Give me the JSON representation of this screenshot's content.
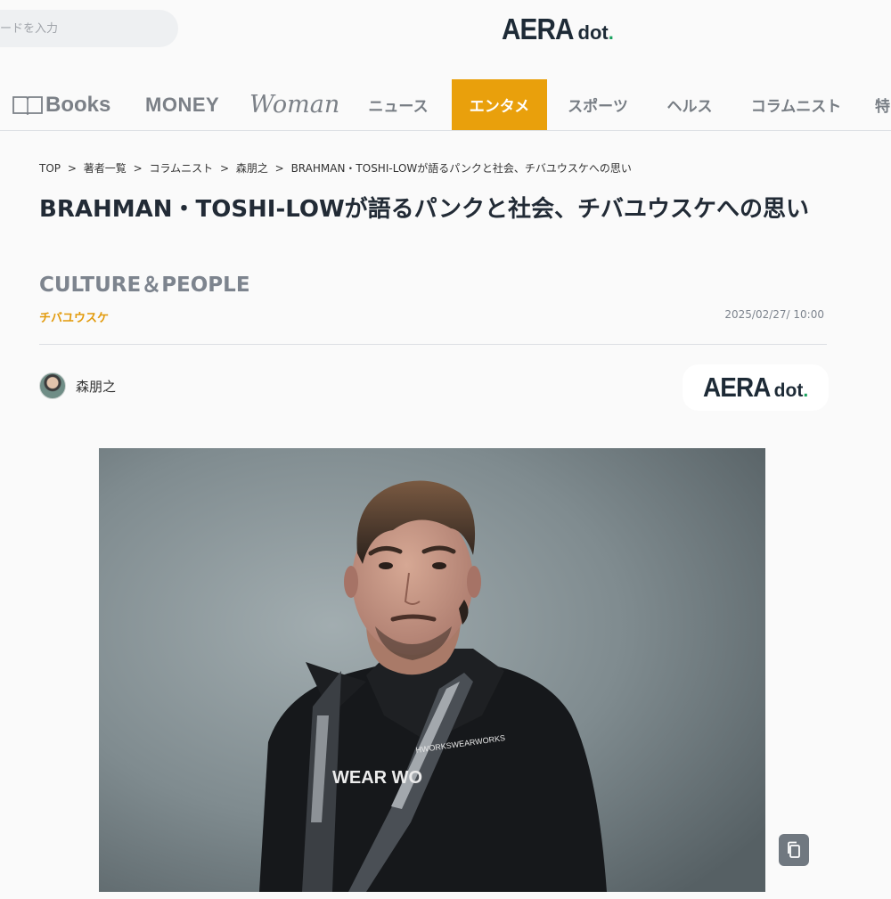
{
  "search": {
    "placeholder": "ードを入力"
  },
  "logo": {
    "main": "AERA",
    "dot": "dot",
    "period": "."
  },
  "nav": {
    "books": "Books",
    "money": "MONEY",
    "woman": "Woman",
    "items": [
      {
        "label": "ニュース",
        "active": false
      },
      {
        "label": "エンタメ",
        "active": true
      },
      {
        "label": "スポーツ",
        "active": false
      },
      {
        "label": "ヘルス",
        "active": false
      },
      {
        "label": "コラムニスト",
        "active": false
      },
      {
        "label": "特",
        "active": false
      }
    ]
  },
  "breadcrumb": [
    "TOP",
    ">",
    "著者一覧",
    ">",
    "コラムニスト",
    ">",
    "森朋之",
    ">",
    "BRAHMAN・TOSHI-LOWが語るパンクと社会、チバユウスケへの思い"
  ],
  "article": {
    "title": "BRAHMAN・TOSHI-LOWが語るパンクと社会、チバユウスケへの思い",
    "category": "CULTURE＆PEOPLE",
    "tag": "チバユウスケ",
    "date": "2025/02/27/ 10:00",
    "author": "森朋之",
    "hoodie_text": "WEAR WO",
    "hoodie_logo": "HWORKSWEARWORKS"
  },
  "colors": {
    "accent": "#e9a00c",
    "brand_green": "#19a25f",
    "navy": "#1d2a36"
  },
  "icons": {
    "books": "book-open-icon",
    "copy": "copy-icon"
  }
}
